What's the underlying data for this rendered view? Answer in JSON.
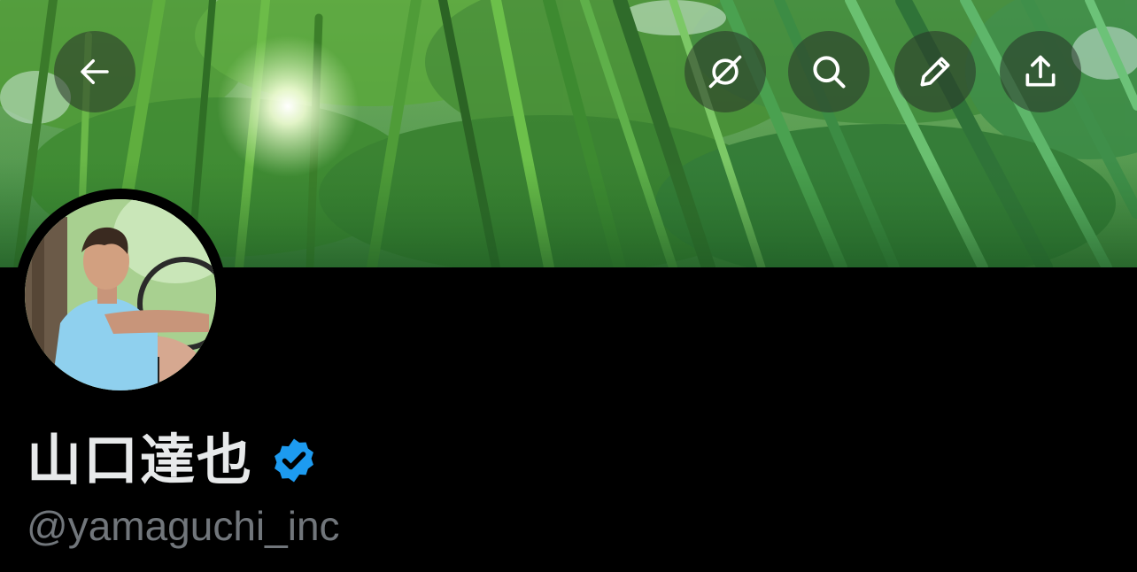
{
  "profile": {
    "display_name": "山口達也",
    "handle": "@yamaguchi_inc",
    "verified": true
  },
  "header": {
    "buttons": [
      {
        "name": "back",
        "icon": "arrow-left-icon"
      },
      {
        "name": "grok",
        "icon": "grok-icon"
      },
      {
        "name": "search",
        "icon": "search-icon"
      },
      {
        "name": "edit",
        "icon": "pencil-icon"
      },
      {
        "name": "share",
        "icon": "share-icon"
      }
    ]
  },
  "colors": {
    "background": "#000000",
    "name_text": "#e7e9ea",
    "handle_text": "#71767b",
    "verified_badge": "#1d9bf0",
    "header_button_bg": "rgba(40,50,40,0.55)"
  },
  "images": {
    "banner": "bamboo forest photo",
    "avatar": "man in light blue t-shirt sitting by tree"
  }
}
